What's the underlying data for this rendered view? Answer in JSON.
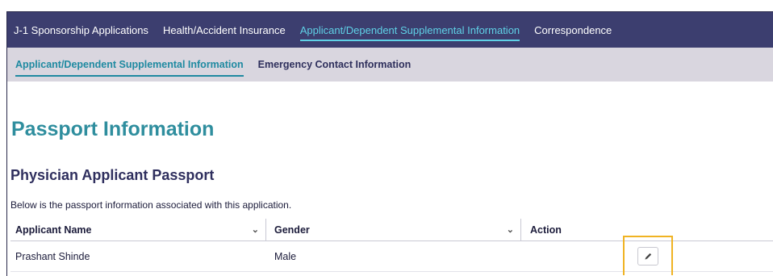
{
  "top_nav": {
    "tabs": [
      {
        "label": "J-1 Sponsorship Applications",
        "active": false
      },
      {
        "label": "Health/Accident Insurance",
        "active": false
      },
      {
        "label": "Applicant/Dependent Supplemental Information",
        "active": true
      },
      {
        "label": "Correspondence",
        "active": false
      }
    ]
  },
  "sub_nav": {
    "tabs": [
      {
        "label": "Applicant/Dependent Supplemental Information",
        "active": true
      },
      {
        "label": "Emergency Contact Information",
        "active": false
      }
    ]
  },
  "page": {
    "title": "Passport Information",
    "section_title": "Physician Applicant Passport",
    "description": "Below is the passport information associated with this application."
  },
  "table": {
    "columns": [
      "Applicant Name",
      "Gender",
      "Action"
    ],
    "rows": [
      {
        "applicant_name": "Prashant Shinde",
        "gender": "Male",
        "action_icon": "pencil-icon"
      }
    ]
  },
  "colors": {
    "nav_bg": "#3c3e6f",
    "subnav_bg": "#d9d6df",
    "accent": "#5fd1e6",
    "title": "#2f8e9e",
    "highlight": "#f0b323"
  }
}
